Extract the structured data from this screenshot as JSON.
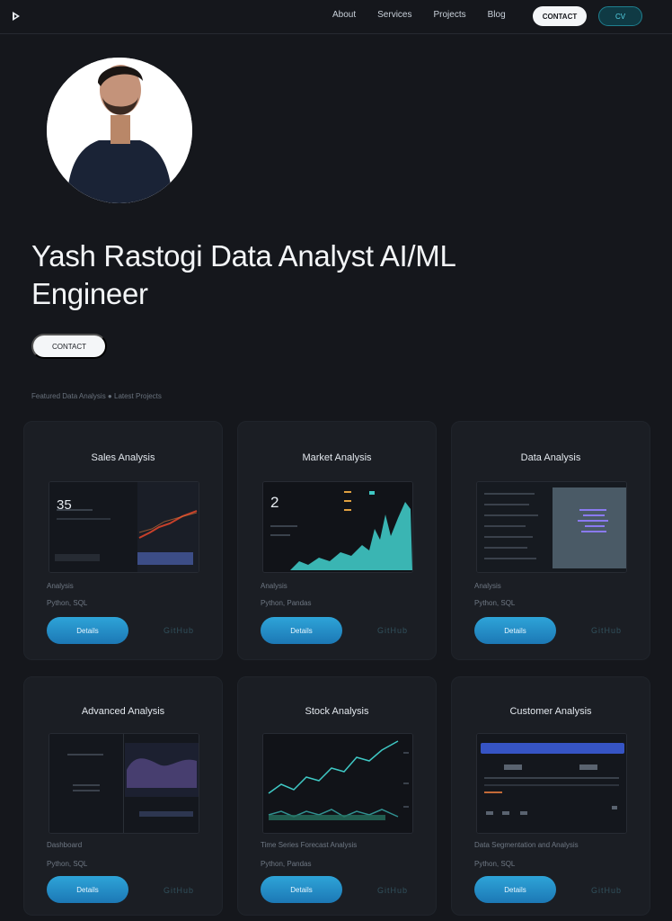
{
  "nav": {
    "links": [
      "About",
      "Services",
      "Projects",
      "Blog"
    ],
    "contact_label": "CONTACT",
    "cv_label": "CV"
  },
  "hero": {
    "title": "Yash Rastogi Data Analyst AI/ML Engineer",
    "cta_label": "CONTACT",
    "subtitle": "Featured Data Analysis ● Latest Projects"
  },
  "projects": [
    {
      "title": "Sales Analysis",
      "thumb_value": "35",
      "meta1": "Analysis",
      "meta2": "Python, SQL",
      "button": "Details",
      "github": "GitHub"
    },
    {
      "title": "Market Analysis",
      "thumb_value": "2",
      "meta1": "Analysis",
      "meta2": "Python, Pandas",
      "button": "Details",
      "github": "GitHub"
    },
    {
      "title": "Data Analysis",
      "thumb_value": "",
      "meta1": "Analysis",
      "meta2": "Python, SQL",
      "button": "Details",
      "github": "GitHub"
    },
    {
      "title": "Advanced Analysis",
      "thumb_value": "",
      "meta1": "Dashboard",
      "meta2": "Python, SQL",
      "button": "Details",
      "github": "GitHub"
    },
    {
      "title": "Stock Analysis",
      "thumb_value": "",
      "meta1": "Time Series Forecast Analysis",
      "meta2": "Python, Pandas",
      "button": "Details",
      "github": "GitHub"
    },
    {
      "title": "Customer Analysis",
      "thumb_value": "",
      "meta1": "Data Segmentation and Analysis",
      "meta2": "Python, SQL",
      "button": "Details",
      "github": "GitHub"
    }
  ],
  "colors": {
    "background": "#15171c",
    "card": "#1b1e24",
    "accent": "#2ea4d8",
    "teal": "#3fc8c4"
  }
}
